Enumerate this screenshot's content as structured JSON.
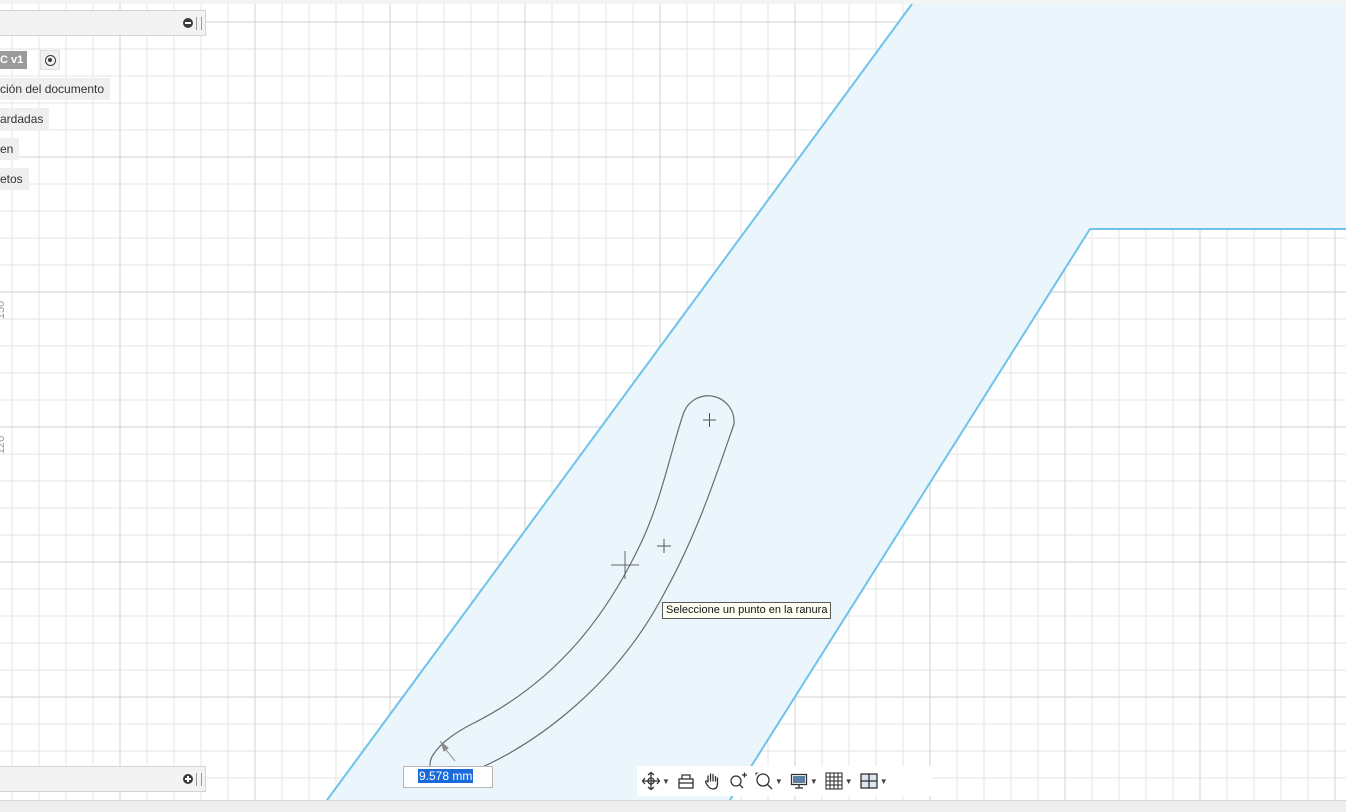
{
  "browser": {
    "version_label": "C v1",
    "items": [
      {
        "label": "ción del documento"
      },
      {
        "label": "ardadas"
      },
      {
        "label": "en"
      },
      {
        "label": "etos"
      }
    ]
  },
  "ruler": {
    "label_upper": "150",
    "label_lower": "120"
  },
  "sketch": {
    "tooltip": "Seleccione un punto en la ranura",
    "dimension_value": "9.578 mm"
  },
  "navigation_toolbar": {
    "tools": [
      {
        "name": "orbit-icon",
        "has_menu": true
      },
      {
        "name": "look-at-icon",
        "has_menu": false
      },
      {
        "name": "pan-icon",
        "has_menu": false
      },
      {
        "name": "zoom-icon",
        "has_menu": false
      },
      {
        "name": "fit-icon",
        "has_menu": true
      },
      {
        "name": "display-settings-icon",
        "has_menu": true
      },
      {
        "name": "grid-icon",
        "has_menu": true
      },
      {
        "name": "viewports-icon",
        "has_menu": true
      }
    ]
  },
  "colors": {
    "sketch_region_fill": "#eaf5fc",
    "sketch_region_stroke": "#6fc3ea",
    "grid_line": "#e3e3e3",
    "slot_line": "#6b6b6b",
    "selection": "#1a6ad9"
  }
}
